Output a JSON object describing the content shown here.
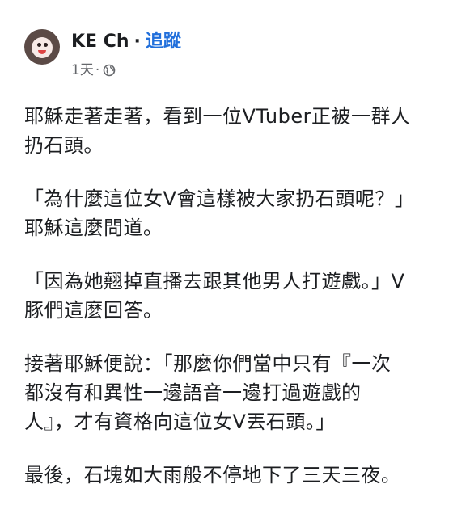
{
  "post": {
    "author": "KE Ch",
    "separator": "·",
    "follow_label": "追蹤",
    "timestamp": "1天",
    "meta_separator": "·",
    "privacy_icon": "globe-icon",
    "paragraphs": [
      "耶穌走著走著，看到一位VTuber正被一群人\n扔石頭。",
      "「為什麼這位女V會這樣被大家扔石頭呢？」\n耶穌這麼問道。",
      "「因為她翹掉直播去跟其他男人打遊戲。」V\n豚們這麼回答。",
      "接著耶穌便說：「那麼你們當中只有『一次\n都沒有和異性一邊語音一邊打過遊戲的\n人』，才有資格向這位女V丟石頭。」",
      "最後，石塊如大雨般不停地下了三天三夜。"
    ]
  },
  "colors": {
    "follow": "#216fdb",
    "meta": "#65676b",
    "text": "#1c1e21"
  }
}
